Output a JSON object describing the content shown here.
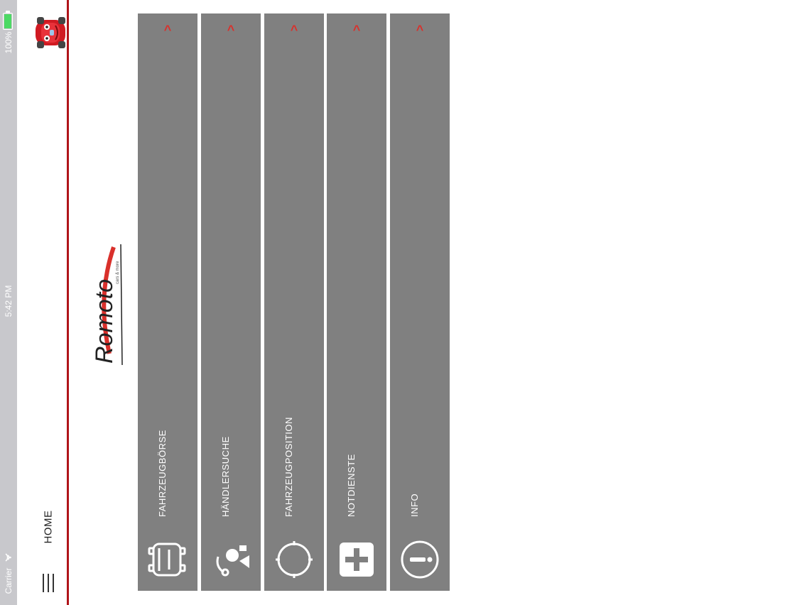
{
  "status_bar": {
    "carrier": "Carrier",
    "time": "5:42 PM",
    "battery": "100%"
  },
  "nav": {
    "title": "HOME",
    "menu_icon": "hamburger-menu-icon",
    "avatar_icon": "red-car-mascot-icon"
  },
  "logo": {
    "text": "Romoto",
    "tagline": "cars & more"
  },
  "tiles": [
    {
      "label": "FAHRZEUGBÖRSE",
      "icon": "car-front-icon"
    },
    {
      "label": "HÄNDLERSUCHE",
      "icon": "dealer-search-icon"
    },
    {
      "label": "FAHRZEUGPOSITION",
      "icon": "compass-icon"
    },
    {
      "label": "NOTDIENSTE",
      "icon": "plus-cross-icon"
    },
    {
      "label": "INFO",
      "icon": "info-icon"
    }
  ],
  "colors": {
    "accent_red": "#d9302b",
    "nav_line": "#b0141a",
    "tile_bg": "#808080",
    "battery_green": "#4cd964"
  }
}
